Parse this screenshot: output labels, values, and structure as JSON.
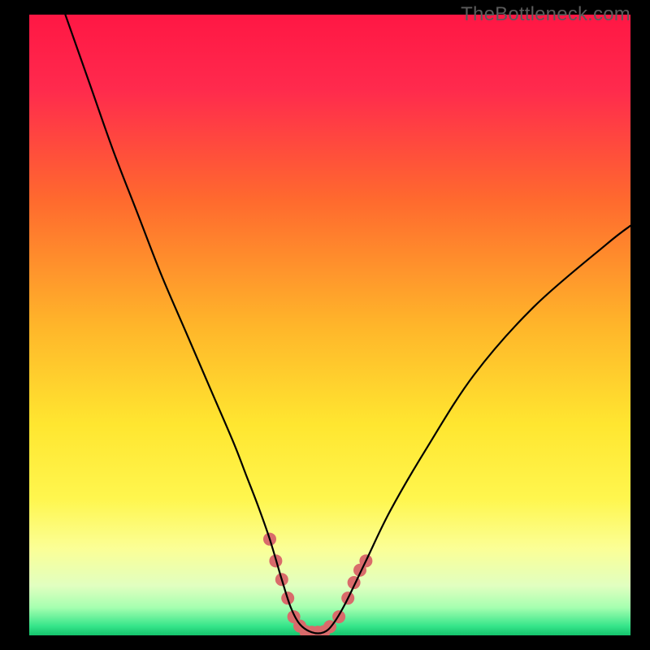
{
  "watermark": "TheBottleneck.com",
  "chart_data": {
    "type": "line",
    "title": "",
    "xlabel": "",
    "ylabel": "",
    "xlim": [
      0,
      100
    ],
    "ylim": [
      0,
      100
    ],
    "background_gradient": {
      "type": "vertical",
      "stops": [
        {
          "pos": 0.0,
          "color": "#ff1744"
        },
        {
          "pos": 0.12,
          "color": "#ff2a4d"
        },
        {
          "pos": 0.3,
          "color": "#ff6a2e"
        },
        {
          "pos": 0.5,
          "color": "#ffb52a"
        },
        {
          "pos": 0.66,
          "color": "#ffe630"
        },
        {
          "pos": 0.78,
          "color": "#fff64e"
        },
        {
          "pos": 0.86,
          "color": "#fbff96"
        },
        {
          "pos": 0.92,
          "color": "#e1ffc0"
        },
        {
          "pos": 0.955,
          "color": "#a6ffb0"
        },
        {
          "pos": 0.985,
          "color": "#36e58a"
        },
        {
          "pos": 1.0,
          "color": "#14c36c"
        }
      ]
    },
    "series": [
      {
        "name": "bottleneck-curve",
        "color": "#000000",
        "width": 2.2,
        "x": [
          6,
          10,
          14,
          18,
          22,
          26,
          30,
          34,
          36,
          38,
          40,
          42,
          43.5,
          45,
          47,
          49,
          50.5,
          52.5,
          56,
          60,
          66,
          74,
          84,
          96,
          100
        ],
        "y": [
          100,
          89,
          78,
          68,
          58,
          49,
          40,
          31,
          26,
          21,
          15.5,
          9,
          4.5,
          1.8,
          0.5,
          0.5,
          1.8,
          5,
          12,
          20,
          30,
          42,
          53,
          63,
          66
        ]
      }
    ],
    "highlight_markers": {
      "name": "optimal-range",
      "color": "#d96b6b",
      "radius": 8,
      "points": [
        {
          "x": 40.0,
          "y": 15.5
        },
        {
          "x": 41.0,
          "y": 12.0
        },
        {
          "x": 42.0,
          "y": 9.0
        },
        {
          "x": 43.0,
          "y": 6.0
        },
        {
          "x": 44.0,
          "y": 3.0
        },
        {
          "x": 45.0,
          "y": 1.5
        },
        {
          "x": 46.0,
          "y": 0.6
        },
        {
          "x": 47.0,
          "y": 0.5
        },
        {
          "x": 48.0,
          "y": 0.5
        },
        {
          "x": 49.0,
          "y": 0.6
        },
        {
          "x": 50.0,
          "y": 1.4
        },
        {
          "x": 51.5,
          "y": 3.0
        },
        {
          "x": 53.0,
          "y": 6.0
        },
        {
          "x": 54.0,
          "y": 8.5
        },
        {
          "x": 55.0,
          "y": 10.5
        },
        {
          "x": 56.0,
          "y": 12.0
        }
      ]
    }
  }
}
